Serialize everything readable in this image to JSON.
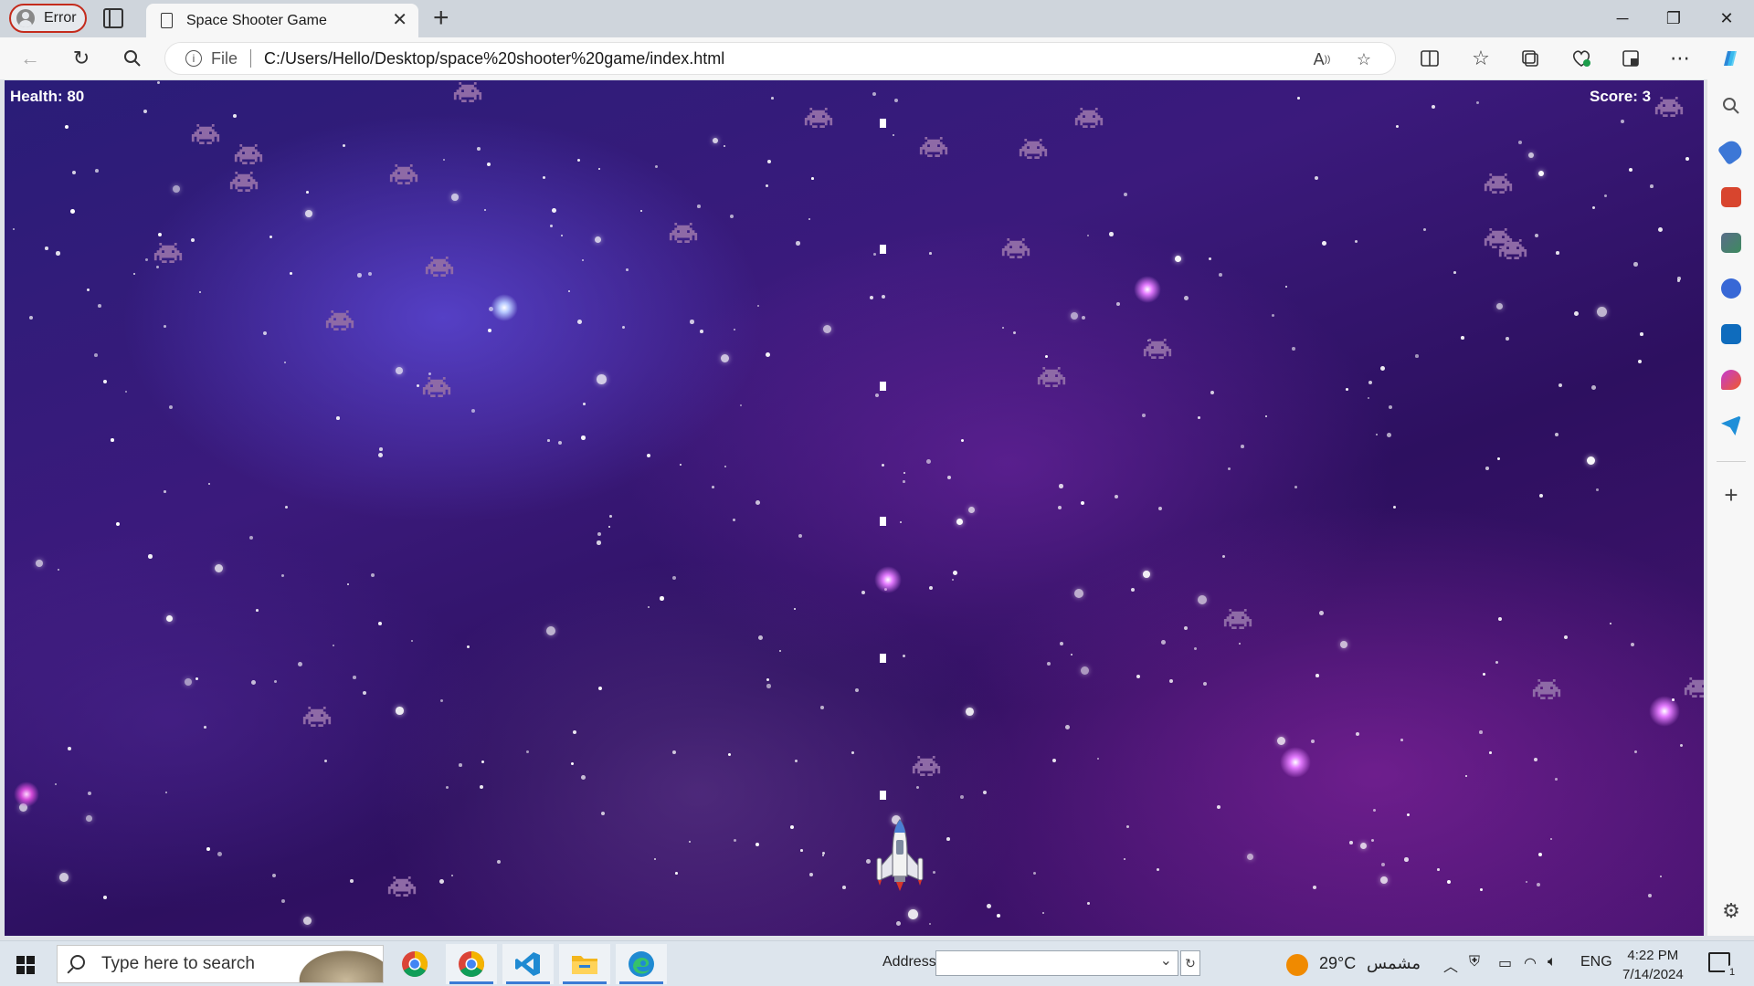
{
  "browser": {
    "profile_label": "Error",
    "tab_title": "Space Shooter Game",
    "address_scheme_label": "File",
    "url": "C:/Users/Hello/Desktop/space%20shooter%20game/index.html"
  },
  "game": {
    "health_text": "Health: 80",
    "score_text": "Score: 3",
    "colors": {
      "invader": "#8e6aa6",
      "bullet": "#ffffff",
      "hud_text": "#ffffff"
    }
  },
  "taskbar": {
    "search_placeholder": "Type here to search",
    "address_label": "Address",
    "weather_temp": "29°C",
    "weather_desc": "مشمس",
    "language": "ENG",
    "time": "4:22 PM",
    "date": "7/14/2024",
    "notification_count": "1",
    "apps": [
      "chrome-icon",
      "chrome-icon",
      "vscode-icon",
      "file-explorer-icon",
      "edge-icon"
    ]
  }
}
